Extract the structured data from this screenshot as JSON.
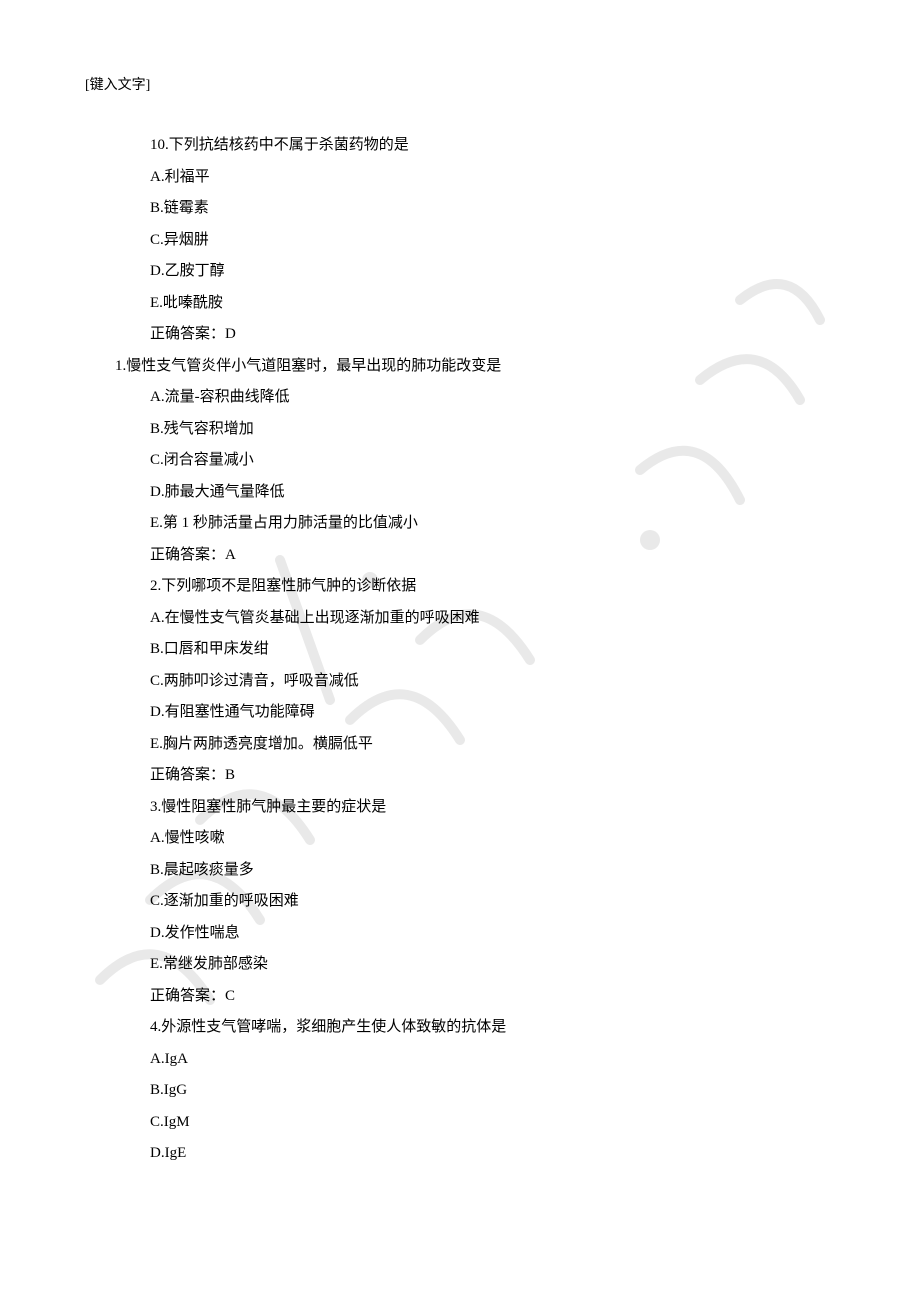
{
  "header": {
    "placeholder": "[键入文字]"
  },
  "lines": [
    {
      "cls": "line",
      "text": "10.下列抗结核药中不属于杀菌药物的是"
    },
    {
      "cls": "line",
      "text": "A.利福平"
    },
    {
      "cls": "line",
      "text": "B.链霉素"
    },
    {
      "cls": "line",
      "text": "C.异烟肼"
    },
    {
      "cls": "line",
      "text": "D.乙胺丁醇"
    },
    {
      "cls": "line",
      "text": "E.吡嗪酰胺"
    },
    {
      "cls": "line",
      "text": "正确答案：D"
    },
    {
      "cls": "line q-line",
      "text": "1.慢性支气管炎伴小气道阻塞时，最早出现的肺功能改变是"
    },
    {
      "cls": "line",
      "text": "A.流量-容积曲线降低"
    },
    {
      "cls": "line",
      "text": "B.残气容积增加"
    },
    {
      "cls": "line",
      "text": "C.闭合容量减小"
    },
    {
      "cls": "line",
      "text": "D.肺最大通气量降低"
    },
    {
      "cls": "line",
      "text": "E.第 1 秒肺活量占用力肺活量的比值减小"
    },
    {
      "cls": "line",
      "text": "正确答案：A"
    },
    {
      "cls": "line",
      "text": "2.下列哪项不是阻塞性肺气肿的诊断依据"
    },
    {
      "cls": "line",
      "text": "A.在慢性支气管炎基础上出现逐渐加重的呼吸困难"
    },
    {
      "cls": "line",
      "text": "B.口唇和甲床发绀"
    },
    {
      "cls": "line",
      "text": "C.两肺叩诊过清音，呼吸音减低"
    },
    {
      "cls": "line",
      "text": "D.有阻塞性通气功能障碍"
    },
    {
      "cls": "line",
      "text": "E.胸片两肺透亮度增加。横膈低平"
    },
    {
      "cls": "line",
      "text": "正确答案：B"
    },
    {
      "cls": "line",
      "text": "3.慢性阻塞性肺气肿最主要的症状是"
    },
    {
      "cls": "line",
      "text": "A.慢性咳嗽"
    },
    {
      "cls": "line",
      "text": "B.晨起咳痰量多"
    },
    {
      "cls": "line",
      "text": "C.逐渐加重的呼吸困难"
    },
    {
      "cls": "line",
      "text": "D.发作性喘息"
    },
    {
      "cls": "line",
      "text": "E.常继发肺部感染"
    },
    {
      "cls": "line",
      "text": "正确答案：C"
    },
    {
      "cls": "line",
      "text": "4.外源性支气管哮喘，浆细胞产生使人体致敏的抗体是"
    },
    {
      "cls": "line",
      "text": "A.IgA"
    },
    {
      "cls": "line",
      "text": "B.IgG"
    },
    {
      "cls": "line",
      "text": "C.IgM"
    },
    {
      "cls": "line",
      "text": "D.IgE"
    }
  ]
}
